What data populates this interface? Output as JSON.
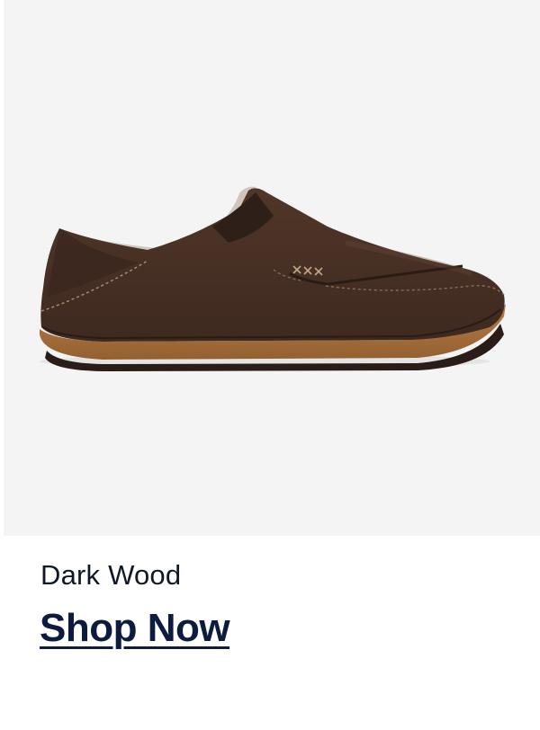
{
  "product": {
    "image_alt": "dark brown leather slip-on shoe",
    "color_name": "Dark Wood",
    "cta_label": "Shop Now"
  },
  "colors": {
    "image_background": "#f4f4f4",
    "leather": "#4a3226",
    "sole": "#a8703f",
    "cta_text": "#0d1b3e"
  }
}
